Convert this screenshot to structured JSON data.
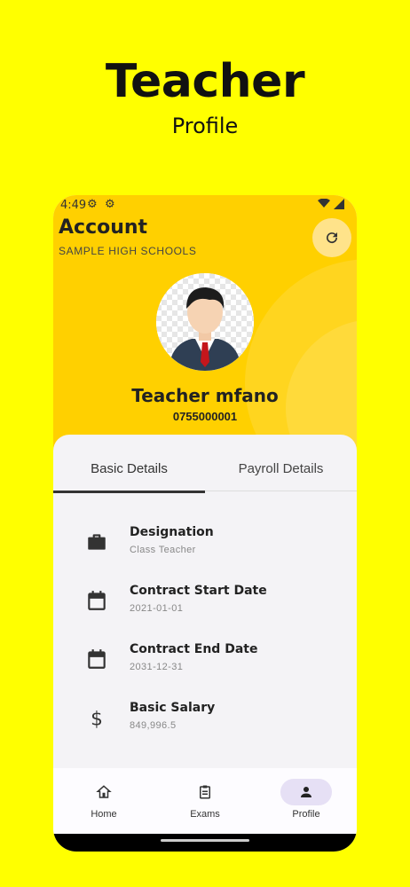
{
  "promo": {
    "title": "Teacher",
    "subtitle": "Profile"
  },
  "status_bar": {
    "time": "4:49"
  },
  "header": {
    "title": "Account",
    "school": "SAMPLE HIGH SCHOOLS",
    "refresh_icon": "refresh-icon",
    "name": "Teacher mfano",
    "phone": "0755000001",
    "accent_color": "#FFD000"
  },
  "tabs": [
    {
      "label": "Basic Details",
      "active": true
    },
    {
      "label": "Payroll Details",
      "active": false
    }
  ],
  "details": [
    {
      "icon": "briefcase-icon",
      "label": "Designation",
      "value": "Class Teacher"
    },
    {
      "icon": "calendar-icon",
      "label": "Contract Start Date",
      "value": "2021-01-01"
    },
    {
      "icon": "calendar-icon",
      "label": "Contract End Date",
      "value": "2031-12-31"
    },
    {
      "icon": "dollar-icon",
      "label": "Basic Salary",
      "value": "849,996.5"
    }
  ],
  "bottom_nav": [
    {
      "icon": "home-icon",
      "label": "Home",
      "active": false
    },
    {
      "icon": "clipboard-icon",
      "label": "Exams",
      "active": false
    },
    {
      "icon": "person-icon",
      "label": "Profile",
      "active": true
    }
  ],
  "colors": {
    "background": "#FFFF00",
    "header": "#FFD000",
    "nav_active": "#e6e0f5"
  }
}
